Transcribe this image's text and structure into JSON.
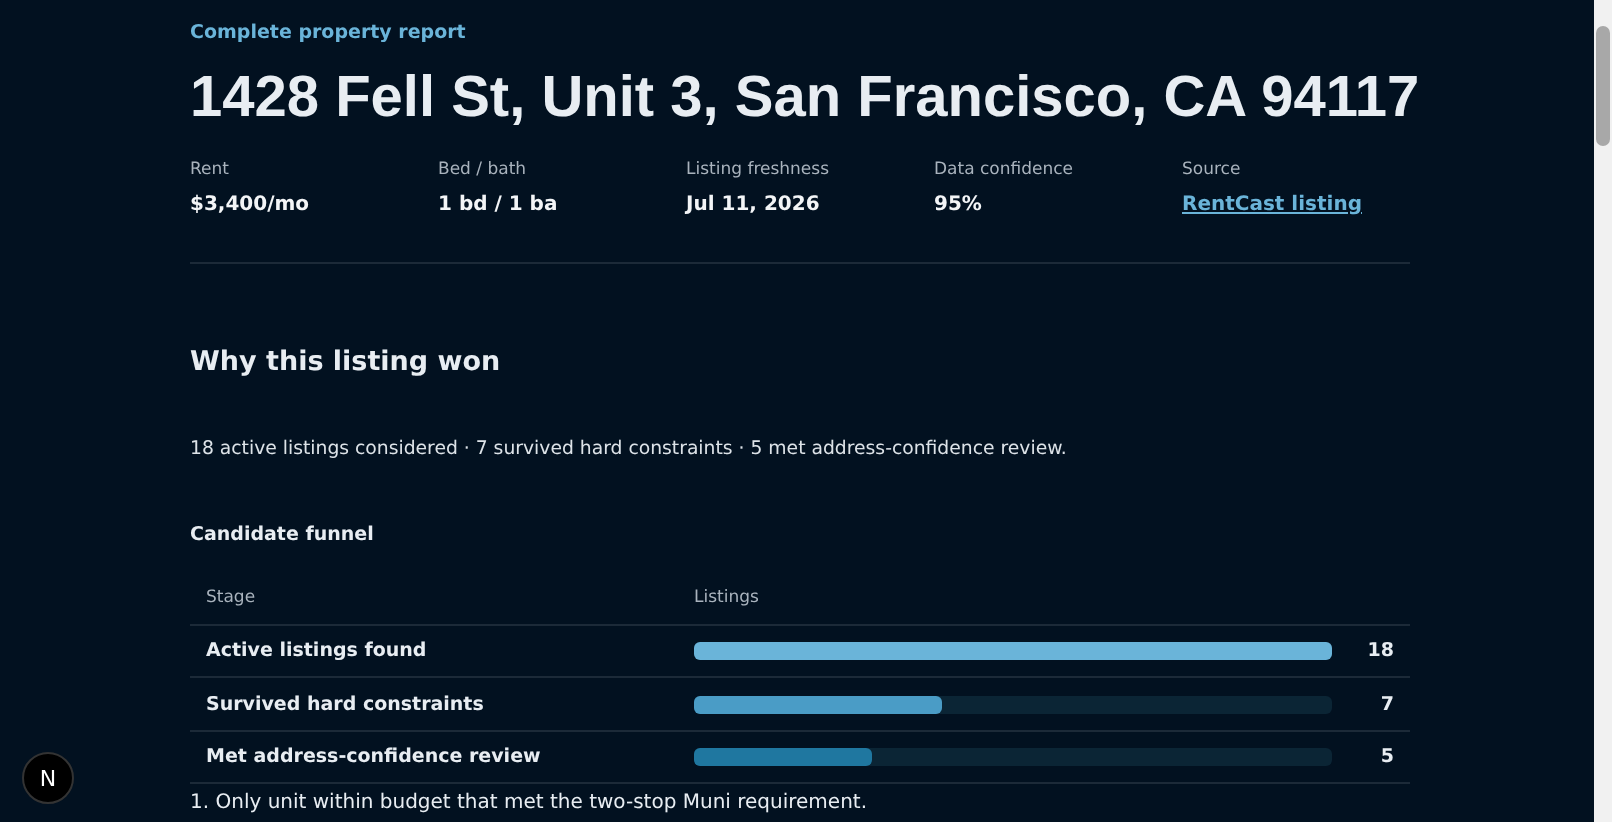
{
  "eyebrow": "Complete property report",
  "title": "1428 Fell St, Unit 3, San Francisco, CA 94117",
  "facts": [
    {
      "label": "Rent",
      "value": "$3,400/mo",
      "kind": "text"
    },
    {
      "label": "Bed / bath",
      "value": "1 bd / 1 ba",
      "kind": "text"
    },
    {
      "label": "Listing freshness",
      "value": "Jul 11, 2026",
      "kind": "text"
    },
    {
      "label": "Data confidence",
      "value": "95%",
      "kind": "text"
    },
    {
      "label": "Source",
      "value": "RentCast listing",
      "kind": "link"
    }
  ],
  "section": {
    "heading": "Why this listing won",
    "summary": "18 active listings considered · 7 survived hard constraints · 5 met address-confidence review."
  },
  "funnel": {
    "heading": "Candidate funnel",
    "columns": [
      "Stage",
      "Listings"
    ],
    "rows": [
      {
        "stage": "Active listings found",
        "level": 1,
        "count": "18",
        "color": "#6ab4d9"
      },
      {
        "stage": "Survived hard constraints",
        "level": 0.389,
        "count": "7",
        "color": "#4a9cc6"
      },
      {
        "stage": "Met address-confidence review",
        "level": 0.278,
        "count": "5",
        "color": "#1f77a0"
      }
    ]
  },
  "reasons": [
    {
      "number": "1.",
      "text": "Only unit within budget that met the two-stop Muni requirement."
    }
  ],
  "badge": "N"
}
